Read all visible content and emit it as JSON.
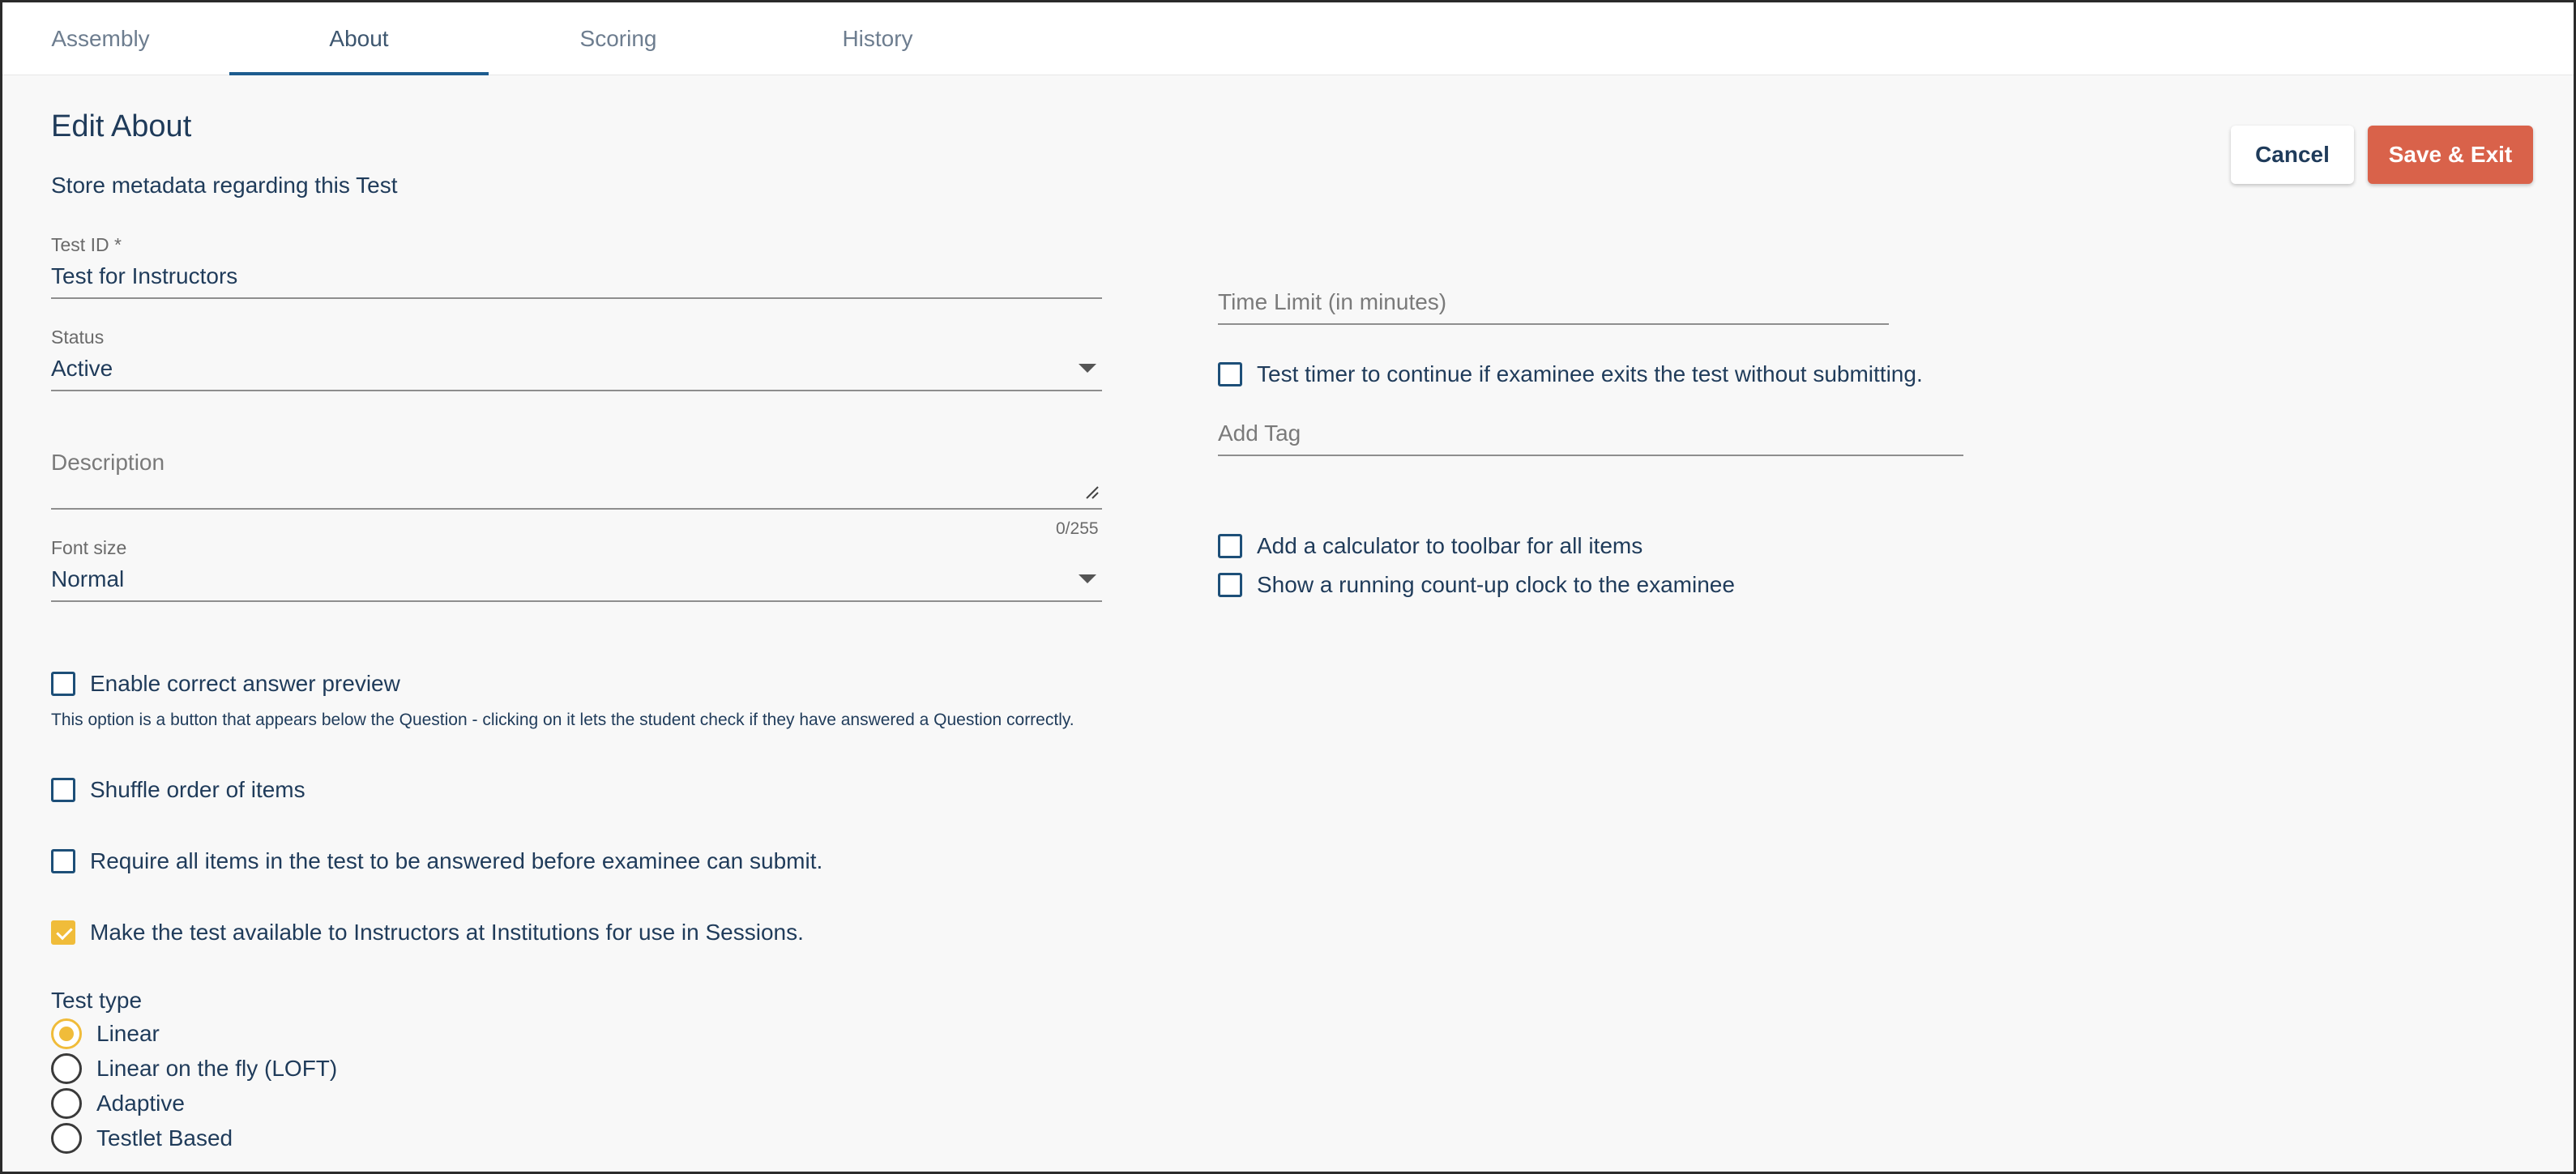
{
  "tabs": [
    {
      "label": "Assembly"
    },
    {
      "label": "About"
    },
    {
      "label": "Scoring"
    },
    {
      "label": "History"
    }
  ],
  "header": {
    "title": "Edit About",
    "subtitle": "Store metadata regarding this Test",
    "cancel_label": "Cancel",
    "save_label": "Save & Exit"
  },
  "form": {
    "test_id": {
      "label": "Test ID *",
      "value": "Test for Instructors"
    },
    "status": {
      "label": "Status",
      "value": "Active"
    },
    "description": {
      "placeholder": "Description",
      "counter": "0/255"
    },
    "font_size": {
      "label": "Font size",
      "value": "Normal"
    },
    "time_limit": {
      "placeholder": "Time Limit (in minutes)"
    },
    "add_tag": {
      "placeholder": "Add Tag"
    }
  },
  "checkboxes": {
    "timer_continue": {
      "label": "Test timer to continue if examinee exits the test without submitting.",
      "checked": false
    },
    "calculator": {
      "label": "Add a calculator to toolbar for all items",
      "checked": false
    },
    "count_up_clock": {
      "label": "Show a running count-up clock to the examinee",
      "checked": false
    },
    "answer_preview": {
      "label": "Enable correct answer preview",
      "checked": false,
      "helper": "This option is a button that appears below the Question - clicking on it lets the student check if they have answered a Question correctly."
    },
    "shuffle": {
      "label": "Shuffle order of items",
      "checked": false
    },
    "require_all": {
      "label": "Require all items in the test to be answered before examinee can submit.",
      "checked": false
    },
    "available_instructors": {
      "label": "Make the test available to Instructors at Institutions for use in Sessions.",
      "checked": true
    }
  },
  "test_type": {
    "label": "Test type",
    "options": [
      {
        "label": "Linear",
        "selected": true
      },
      {
        "label": "Linear on the fly (LOFT)",
        "selected": false
      },
      {
        "label": "Adaptive",
        "selected": false
      },
      {
        "label": "Testlet Based",
        "selected": false
      }
    ]
  },
  "colors": {
    "primary_text": "#1f3b5a",
    "tab_underline": "#1d5c8f",
    "save_button": "#d9624a",
    "accent_checked": "#f0bc3a"
  }
}
